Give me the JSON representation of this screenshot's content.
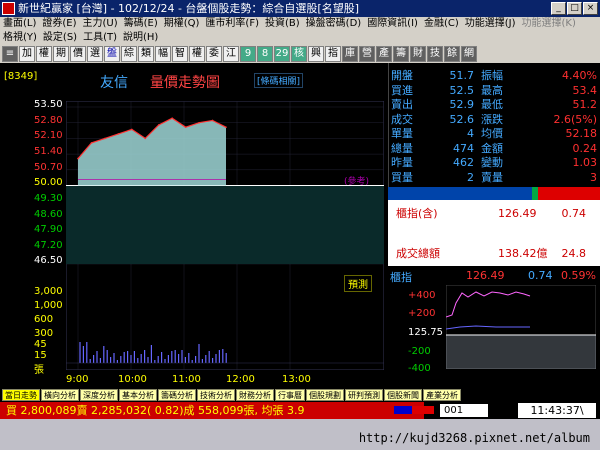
{
  "window": {
    "title": "新世紀贏家 [台灣] - 102/12/24 - 台盤個股走勢：綜合自選股[名望股]",
    "buttons": [
      "_",
      "□",
      "×"
    ]
  },
  "menu1": [
    "畫面(L)",
    "證券(E)",
    "主力(U)",
    "籌碼(E)",
    "期權(Q)",
    "匯市利率(F)",
    "投資(B)",
    "操盤密碼(D)",
    "國際資訊(I)",
    "金融(C)",
    "功能選擇(J)",
    "功能選擇(K)"
  ],
  "menu2": [
    "格視(Y)",
    "設定(S)",
    "工具(T)",
    "說明(H)"
  ],
  "toolbar": [
    "≡",
    "加",
    "權",
    "期",
    "價",
    "選",
    "盤",
    "綜",
    "類",
    "幅",
    "智",
    "權",
    "委",
    "江",
    "9",
    "8",
    "29",
    "核",
    "興",
    "指",
    "庫",
    "營",
    "產",
    "籌",
    "財",
    "技",
    "餘",
    "網"
  ],
  "chart": {
    "stock_code": "[8349]",
    "stock_name": "友信",
    "title": "量價走勢圖",
    "related_button": "[條碼相關]",
    "hint_label": "預測",
    "open_ref_label": "(參考)",
    "time_labels": [
      "9:00",
      "10:00",
      "11:00",
      "12:00",
      "13:00"
    ],
    "price_axis": [
      "53.50",
      "52.80",
      "52.10",
      "51.40",
      "50.70",
      "50.00",
      "49.30",
      "48.60",
      "47.90",
      "47.20",
      "46.50"
    ],
    "volume_axis": [
      "3,000",
      "1,000",
      "600",
      "300",
      "45",
      "15",
      "張"
    ]
  },
  "chart_data": {
    "type": "line",
    "xlabel": "",
    "ylabel": "",
    "x": [
      "9:00",
      "9:15",
      "9:30",
      "9:45",
      "10:00",
      "10:15",
      "10:30",
      "10:45",
      "11:00",
      "11:15",
      "11:30",
      "11:40"
    ],
    "series": [
      {
        "values": [
          51.2,
          51.9,
          52.1,
          52.3,
          52.5,
          52.1,
          52.7,
          53.0,
          52.6,
          52.8,
          52.9,
          52.6
        ]
      }
    ],
    "ylim": [
      46.5,
      53.5
    ],
    "reference_price": 50.0
  },
  "quote": {
    "rows": [
      {
        "l1": "開盤",
        "v1": "51.7",
        "l2": "振幅",
        "v2": "4.40%",
        "c2": "#ff3030"
      },
      {
        "l1": "買進",
        "v1": "52.5",
        "l2": "最高",
        "v2": "53.4",
        "c2": "#ff3030"
      },
      {
        "l1": "賣出",
        "v1": "52.9",
        "l2": "最低",
        "v2": "51.2",
        "c2": "#ff3030"
      },
      {
        "l1": "成交",
        "v1": "52.6",
        "l2": "漲跌",
        "v2": "2.6(5%)",
        "c2": "#ff3030"
      },
      {
        "l1": "單量",
        "v1": "4",
        "l2": "均價",
        "v2": "52.18",
        "c2": "#ff3030"
      },
      {
        "l1": "總量",
        "v1": "474",
        "l2": "金額",
        "v2": "0.24",
        "c2": "#ff3030"
      },
      {
        "l1": "昨量",
        "v1": "462",
        "l2": "變動",
        "v2": "1.03",
        "c2": "#ff3030"
      },
      {
        "l1": "買量",
        "v1": "2",
        "l2": "賣量",
        "v2": "3",
        "c2": "#ff3030"
      }
    ]
  },
  "index_panel": {
    "label1": "櫃指(含)",
    "value1": "126.49",
    "change1": "0.74",
    "label2": "成交總額",
    "value2": "138.42億",
    "change2": "24.8"
  },
  "index_chart": {
    "label": "櫃指",
    "value": "126.49",
    "change": "0.74",
    "percent": "0.59%",
    "axis": [
      "+400",
      "+200",
      "125.75",
      "-200",
      "-400"
    ]
  },
  "tabs": [
    "當日走勢",
    "橫向分析",
    "深度分析",
    "基本分析",
    "籌碼分析",
    "技術分析",
    "財務分析",
    "行事曆",
    "個股規劃",
    "研判預測",
    "個股新聞",
    "產業分析"
  ],
  "status": {
    "ticker": "買 2,800,089賣 2,285,032( 0.82)成 558,099張, 均張 3.9",
    "code": "001",
    "clock": "11:43:37\\"
  },
  "footer": {
    "url": "http://kujd3268.pixnet.net/album"
  }
}
